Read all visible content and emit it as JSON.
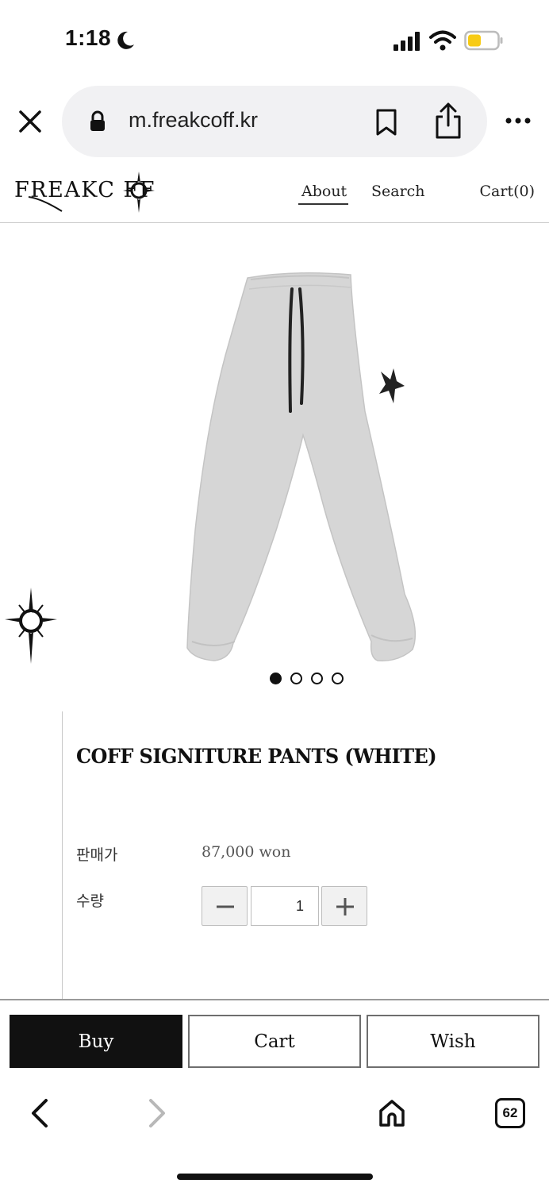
{
  "status_bar": {
    "time": "1:18",
    "icons": [
      "moon-icon",
      "signal-icon",
      "wifi-icon",
      "battery-icon"
    ],
    "battery_color": "#f7cb15"
  },
  "browser": {
    "url": "m.freakcoff.kr",
    "icons": [
      "close-icon",
      "lock-icon",
      "bookmark-icon",
      "share-icon",
      "more-icon"
    ]
  },
  "header": {
    "logo_text": "FREAKC FF",
    "nav": {
      "about": "About",
      "search": "Search",
      "cart": "Cart(0)"
    }
  },
  "carousel": {
    "total": 4,
    "active_index": 0
  },
  "product": {
    "title": "COFF SIGNITURE PANTS (WHITE)",
    "price_label": "판매가",
    "price_value": "87,000 won",
    "quantity_label": "수량",
    "quantity_value": "1"
  },
  "actions": {
    "buy": "Buy",
    "cart": "Cart",
    "wish": "Wish"
  },
  "toolbar": {
    "tabs_count": "62",
    "icons": [
      "back-icon",
      "forward-icon",
      "home-icon",
      "tabs-icon"
    ]
  },
  "colors": {
    "primary_button": "#111111",
    "pants": "#d6d6d6"
  }
}
